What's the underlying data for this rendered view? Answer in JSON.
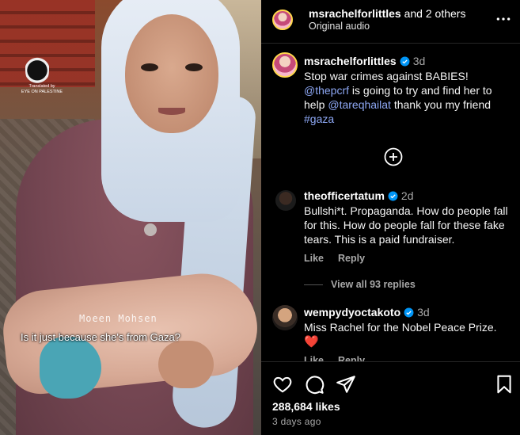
{
  "video": {
    "watermark_line1": "Translated by",
    "watermark_line2": "EYE ON PALESTINE",
    "subtitle_name": "Moeen Mohsen",
    "subtitle_text": "Is it just because she's from Gaza?"
  },
  "header": {
    "username": "msrachelforlittles",
    "others": " and 2 others",
    "audio": "Original audio",
    "more_icon": "more-horizontal-icon"
  },
  "caption": {
    "username": "msrachelforlittles",
    "time": "3d",
    "line1": "Stop war crimes against BABIES!",
    "mention1": "@thepcrf",
    "line2_mid": " is going to try and find her to help ",
    "mention2": "@tareqhailat",
    "line2_end": " thank you my friend ",
    "hashtag": "#gaza"
  },
  "comments": [
    {
      "username": "theofficertatum",
      "time": "2d",
      "text": "Bullshi*t. Propaganda. How do people fall for this. How do people fall for these fake tears. This is a paid fundraiser.",
      "like": "Like",
      "reply": "Reply",
      "view_replies": "View all 93 replies"
    },
    {
      "username": "wempydyoctakoto",
      "time": "3d",
      "text": "Miss Rachel for the Nobel Peace Prize.",
      "emoji": "❤️",
      "like": "Like",
      "reply": "Reply"
    }
  ],
  "footer": {
    "likes": "288,684 likes",
    "time_ago": "3 days ago",
    "icons": [
      "heart-icon",
      "comment-icon",
      "share-icon",
      "bookmark-icon"
    ]
  },
  "colors": {
    "link": "#8ea8f5",
    "verified": "#0095f6",
    "muted": "#a8a8a8"
  }
}
